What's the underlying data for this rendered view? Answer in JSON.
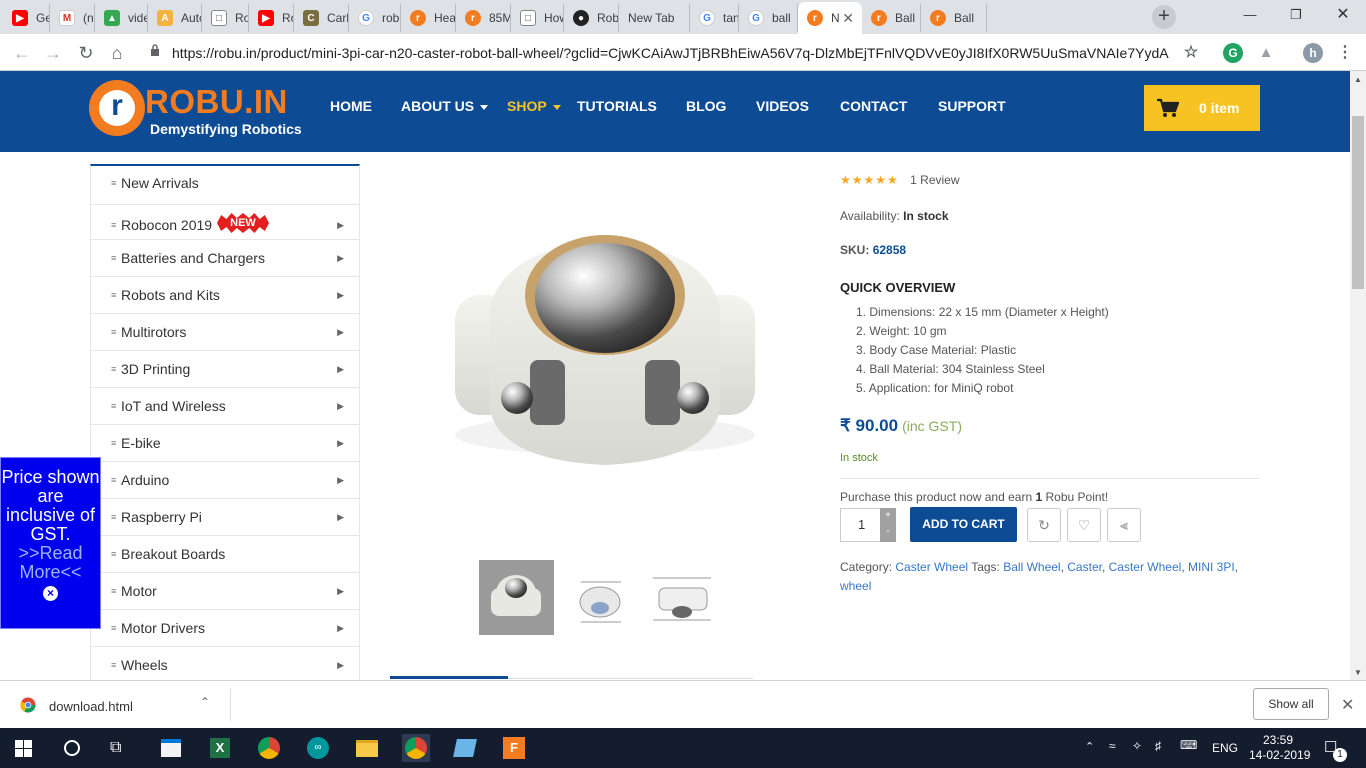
{
  "browser": {
    "tabs": [
      {
        "label": "Gett",
        "icon": "youtube-icon"
      },
      {
        "label": "(no",
        "icon": "gmail-icon"
      },
      {
        "label": "vide",
        "icon": "drive-icon"
      },
      {
        "label": "Auto",
        "icon": "auto-icon"
      },
      {
        "label": "Rob",
        "icon": "doc-icon"
      },
      {
        "label": "Rob",
        "icon": "youtube-icon"
      },
      {
        "label": "Carb",
        "icon": "misc-icon"
      },
      {
        "label": "robo",
        "icon": "google-icon"
      },
      {
        "label": "Hea",
        "icon": "robu-icon"
      },
      {
        "label": "85M",
        "icon": "robu-icon"
      },
      {
        "label": "How",
        "icon": "doc-icon"
      },
      {
        "label": "Rob",
        "icon": "dark-icon"
      },
      {
        "label": "New Tab",
        "icon": ""
      },
      {
        "label": "tana",
        "icon": "google-icon"
      },
      {
        "label": "ball",
        "icon": "google-icon"
      },
      {
        "label": "N",
        "icon": "robu-icon"
      },
      {
        "label": "Ball",
        "icon": "robu-icon"
      },
      {
        "label": "Ball",
        "icon": "robu-icon"
      }
    ],
    "url": "https://robu.in/product/mini-3pi-car-n20-caster-robot-ball-wheel/?gclid=CjwKCAiAwJTjBRBhEiwA56V7q-DlzMbEjTFnlVQDVvE0yJI8IfX0RW5UuSmaVNAIe7YydA...",
    "profile_initial": "h"
  },
  "site": {
    "logo_letter": "r",
    "logo_name": "ROBU.IN",
    "tagline": "Demystifying Robotics",
    "nav": [
      {
        "label": "HOME",
        "dropdown": false,
        "active": false
      },
      {
        "label": "ABOUT US",
        "dropdown": true,
        "active": false
      },
      {
        "label": "SHOP",
        "dropdown": true,
        "active": true
      },
      {
        "label": "TUTORIALS",
        "dropdown": false,
        "active": false
      },
      {
        "label": "BLOG",
        "dropdown": false,
        "active": false
      },
      {
        "label": "VIDEOS",
        "dropdown": false,
        "active": false
      },
      {
        "label": "CONTACT",
        "dropdown": false,
        "active": false
      },
      {
        "label": "SUPPORT",
        "dropdown": false,
        "active": false
      }
    ],
    "cart_label": "0 item",
    "colors": {
      "header": "#0d4c95",
      "accent": "#f47c20",
      "shop_active": "#f7c322"
    }
  },
  "sidebar": {
    "categories": [
      {
        "label": "New Arrivals",
        "has_arrow": false
      },
      {
        "label": "Robocon 2019",
        "has_arrow": true
      },
      {
        "label": "Batteries and Chargers",
        "has_arrow": true
      },
      {
        "label": "Robots and Kits",
        "has_arrow": true
      },
      {
        "label": "Multirotors",
        "has_arrow": true
      },
      {
        "label": "3D Printing",
        "has_arrow": true
      },
      {
        "label": "IoT and Wireless",
        "has_arrow": true
      },
      {
        "label": "E-bike",
        "has_arrow": true
      },
      {
        "label": "Arduino",
        "has_arrow": true
      },
      {
        "label": "Raspberry Pi",
        "has_arrow": true
      },
      {
        "label": "Breakout Boards",
        "has_arrow": false
      },
      {
        "label": "Motor",
        "has_arrow": true
      },
      {
        "label": "Motor Drivers",
        "has_arrow": true
      },
      {
        "label": "Wheels",
        "has_arrow": true
      }
    ],
    "new_badge": "NEW"
  },
  "gst_notice": {
    "text": "Price shown are inclusive of GST.",
    "link": ">>Read More<<",
    "close": "×"
  },
  "product": {
    "rating_stars": "★★★★★",
    "review_count": "1 Review",
    "availability_label": "Availability:",
    "availability_value": "In stock",
    "sku_label": "SKU:",
    "sku_value": "62858",
    "overview_title": "QUICK OVERVIEW",
    "specs": [
      "Dimensions: 22 x 15 mm (Diameter x Height)",
      "Weight: 10 gm",
      "Body Case Material: Plastic",
      "Ball Material: 304 Stainless Steel",
      "Application: for MiniQ robot"
    ],
    "price": "₹ 90.00",
    "price_note": "(inc GST)",
    "stock_status": "In stock",
    "points_pre": "Purchase this product now and earn",
    "points_value": "1",
    "points_post": "Robu Point!",
    "quantity": "1",
    "add_to_cart": "ADD TO CART",
    "category_label": "Category:",
    "category": "Caster Wheel",
    "tags_label": "Tags:",
    "tags": [
      "Ball Wheel",
      "Caster",
      "Caster Wheel",
      "MINI 3PI",
      "wheel"
    ]
  },
  "downloads": {
    "filename": "download.html",
    "show_all": "Show all"
  },
  "taskbar": {
    "language": "ENG",
    "time": "23:59",
    "date": "14-02-2019",
    "notifications": "1"
  }
}
